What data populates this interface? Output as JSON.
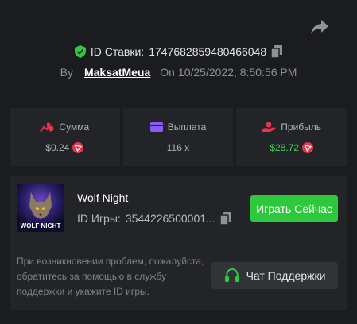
{
  "bet": {
    "id_label": "ID Ставки:",
    "id_value": "1747682859480466048"
  },
  "meta": {
    "by_label": "By",
    "username": "MaksatMeua",
    "on_label": "On",
    "datetime": "10/25/2022, 8:50:56 PM"
  },
  "stats": {
    "amount": {
      "label": "Сумма",
      "value": "$0.24"
    },
    "payout": {
      "label": "Выплата",
      "value": "116 x"
    },
    "profit": {
      "label": "Прибыль",
      "value": "$28.72"
    }
  },
  "game": {
    "thumb_text": "WOLF NIGHT",
    "name": "Wolf Night",
    "id_label": "ID Игры:",
    "id_value": "3544226500001...",
    "play_label": "Играть Сейчас"
  },
  "support": {
    "help_text": "При возникновении проблем, пожалуйста, обратитесь за помощью в службу поддержки и укажите ID игры.",
    "button_label": "Чат Поддержки"
  },
  "colors": {
    "background": "#1b1c1f",
    "card": "#232428",
    "accent_green": "#2ec83c",
    "profit_green": "#3ed24f",
    "tron_red": "#e8334a",
    "icon_pink": "#e8334a",
    "icon_purple": "#8b5cf6"
  },
  "icons": {
    "share": "share-icon",
    "verified": "shield-check-icon",
    "copy": "copy-icon",
    "amount": "coins-icon",
    "payout": "wallet-icon",
    "profit": "hand-coin-icon",
    "currency": "tron-icon",
    "support": "headset-icon"
  }
}
